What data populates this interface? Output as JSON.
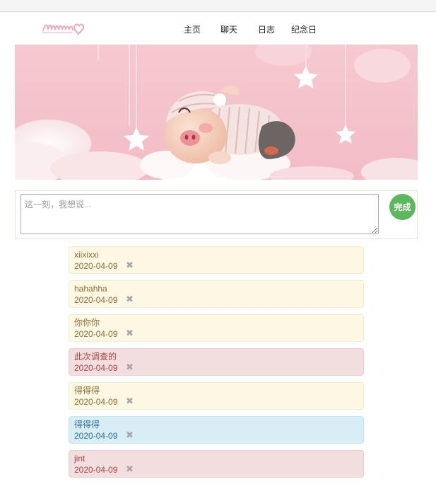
{
  "nav": {
    "items": [
      {
        "label": "主页"
      },
      {
        "label": "聊天"
      },
      {
        "label": "日志"
      },
      {
        "label": "纪念日"
      }
    ]
  },
  "banner": {
    "icons": [
      "moon-icon",
      "star-icon",
      "pig-illustration",
      "cloud-icon"
    ],
    "colors": {
      "background": "#f4c6cc",
      "pig": "#f7d8c8",
      "pajama": "#f2e4e0"
    }
  },
  "composer": {
    "placeholder": "这一刻，我想说...",
    "value": "",
    "submit_label": "完成"
  },
  "entries": [
    {
      "text": "xiixixxi",
      "date": "2020-04-09",
      "style": "warning",
      "delete_icon": "close-icon"
    },
    {
      "text": "hahahha",
      "date": "2020-04-09",
      "style": "warning",
      "delete_icon": "close-icon"
    },
    {
      "text": "你你你",
      "date": "2020-04-09",
      "style": "warning",
      "delete_icon": "close-icon"
    },
    {
      "text": "此次调查的",
      "date": "2020-04-09",
      "style": "danger",
      "delete_icon": "close-icon"
    },
    {
      "text": "得得得",
      "date": "2020-04-09",
      "style": "warning",
      "delete_icon": "close-icon"
    },
    {
      "text": "得得得",
      "date": "2020-04-09",
      "style": "info",
      "delete_icon": "close-icon"
    },
    {
      "text": "jint",
      "date": "2020-04-09",
      "style": "danger",
      "delete_icon": "close-icon"
    }
  ],
  "colors": {
    "warning_bg": "#fcf8e3",
    "danger_bg": "#f2dede",
    "info_bg": "#d9edf7",
    "submit_bg": "#5cb85c"
  }
}
